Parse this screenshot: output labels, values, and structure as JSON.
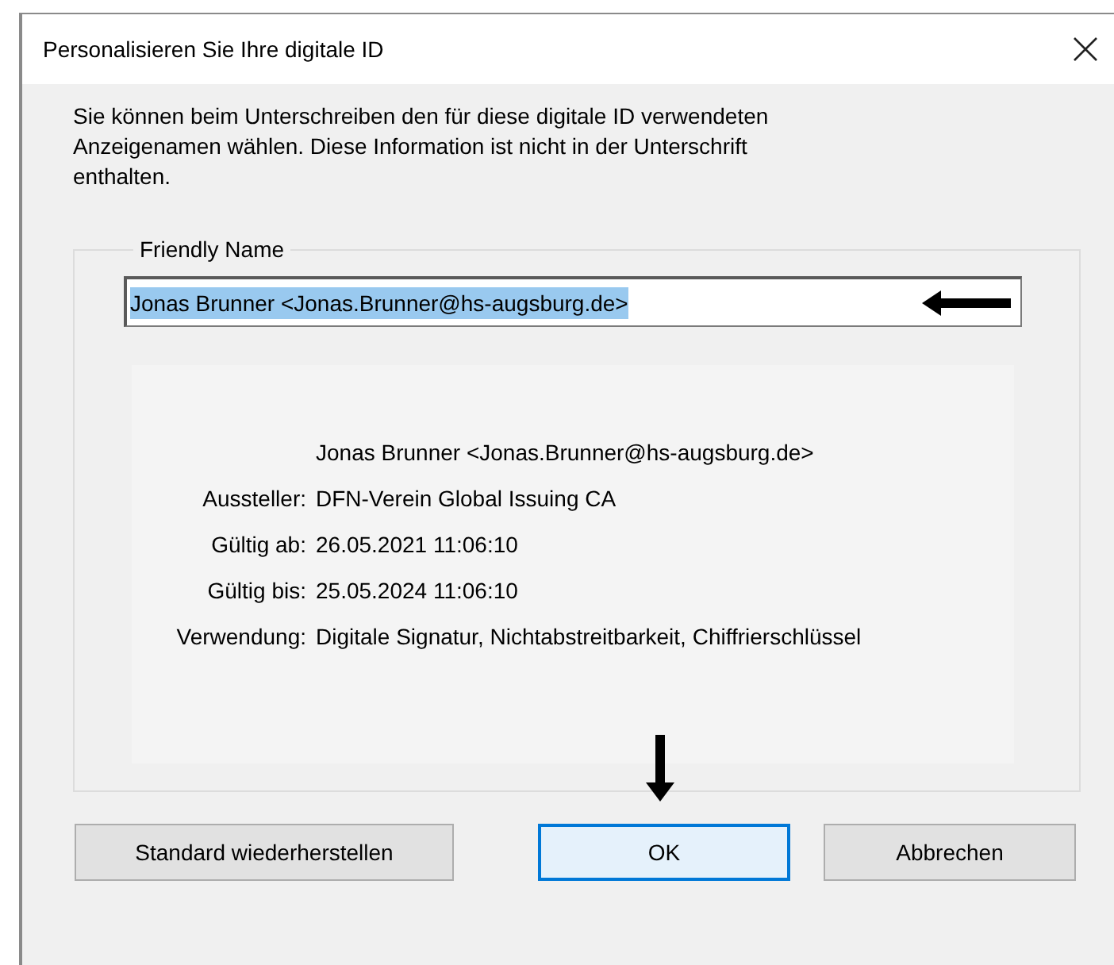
{
  "window": {
    "title": "Personalisieren Sie Ihre digitale ID"
  },
  "intro": "Sie können beim Unterschreiben den für diese digitale ID verwendeten Anzeigenamen wählen. Diese Information ist nicht in der Unterschrift enthalten.",
  "friendly_name": {
    "label": "Friendly Name",
    "value": "Jonas Brunner <Jonas.Brunner@hs-augsburg.de>",
    "selected": true
  },
  "details": [
    {
      "value": "Jonas Brunner <Jonas.Brunner@hs-augsburg.de>"
    },
    {
      "label": "Aussteller:",
      "value": "DFN-Verein Global Issuing CA"
    },
    {
      "label": "Gültig ab:",
      "value": "26.05.2021 11:06:10"
    },
    {
      "label": "Gültig bis:",
      "value": "25.05.2024 11:06:10"
    },
    {
      "label": "Verwendung:",
      "value": "Digitale Signatur, Nichtabstreitbarkeit, Chiffrierschlüssel"
    }
  ],
  "buttons": [
    {
      "label": "Standard wiederherstellen",
      "focused": false
    },
    {
      "label": "OK",
      "focused": true
    },
    {
      "label": "Abbrechen",
      "focused": false
    }
  ]
}
